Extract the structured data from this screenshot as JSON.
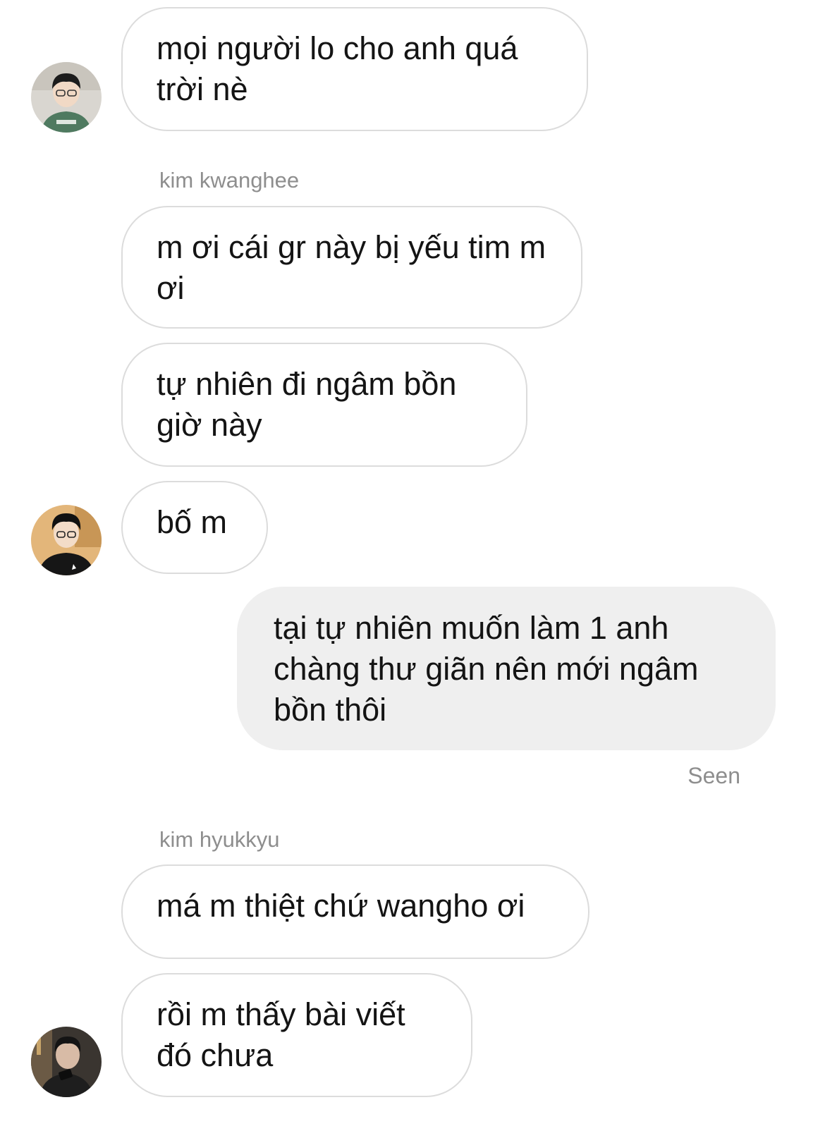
{
  "messages": [
    {
      "sender": "",
      "text": "mọi người lo cho anh quá trời nè"
    },
    {
      "sender": "kim kwanghee",
      "text": "m ơi cái gr này bị yếu tim m ơi"
    },
    {
      "sender": "kim kwanghee",
      "text": "tự nhiên đi ngâm bồn giờ này"
    },
    {
      "sender": "kim kwanghee",
      "text": "bố m"
    },
    {
      "sender": "me",
      "text": "tại tự nhiên muốn làm 1 anh chàng thư giãn nên mới ngâm bồn thôi"
    },
    {
      "sender": "kim hyukkyu",
      "text": "má m thiệt chứ wangho ơi"
    },
    {
      "sender": "kim hyukkyu",
      "text": "rồi m thấy bài viết đó chưa"
    }
  ],
  "labels": {
    "kwanghee": "kim kwanghee",
    "hyukkyu": "kim hyukkyu",
    "seen": "Seen"
  },
  "avatars": [
    {
      "icon": "person-avatar-icon",
      "background": "#d9d6d0",
      "shirt": "#4f7a60"
    },
    {
      "icon": "person-avatar-icon",
      "background": "#e3b67a",
      "shirt": "#161616"
    },
    {
      "icon": "person-avatar-icon",
      "background": "#3a3530",
      "shirt": "#1e1e1e"
    }
  ],
  "colors": {
    "bubble_border": "#dcdcdc",
    "my_bubble": "#efefef",
    "meta_text": "#8e8e8e"
  }
}
